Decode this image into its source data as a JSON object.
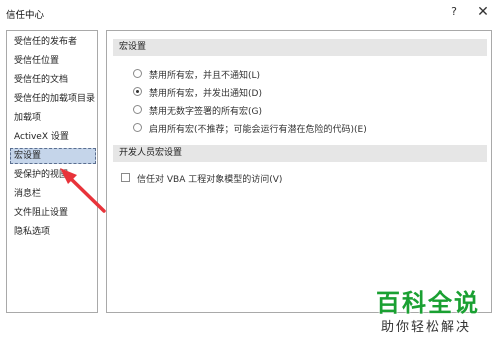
{
  "window": {
    "title": "信任中心",
    "help_glyph": "?",
    "close_glyph": "✕"
  },
  "sidebar": {
    "items": [
      {
        "label": "受信任的发布者"
      },
      {
        "label": "受信任位置"
      },
      {
        "label": "受信任的文档"
      },
      {
        "label": "受信任的加载项目录"
      },
      {
        "label": "加载项"
      },
      {
        "label": "ActiveX 设置"
      },
      {
        "label": "宏设置",
        "selected": true
      },
      {
        "label": "受保护的视图"
      },
      {
        "label": "消息栏"
      },
      {
        "label": "文件阻止设置"
      },
      {
        "label": "隐私选项"
      }
    ]
  },
  "macro_settings": {
    "heading": "宏设置",
    "options": [
      {
        "label": "禁用所有宏，并且不通知(L)",
        "checked": false
      },
      {
        "label": "禁用所有宏，并发出通知(D)",
        "checked": true
      },
      {
        "label": "禁用无数字签署的所有宏(G)",
        "checked": false
      },
      {
        "label": "启用所有宏(不推荐；可能会运行有潜在危险的代码)(E)",
        "checked": false
      }
    ]
  },
  "developer_settings": {
    "heading": "开发人员宏设置",
    "trust_vba_label": "信任对 VBA 工程对象模型的访问(V)",
    "trust_vba_checked": false
  },
  "annotation": {
    "arrow_color": "#e8333a"
  },
  "watermark": {
    "line1": "百科全说",
    "line2": "助你轻松解决",
    "color": "#1aa032"
  }
}
